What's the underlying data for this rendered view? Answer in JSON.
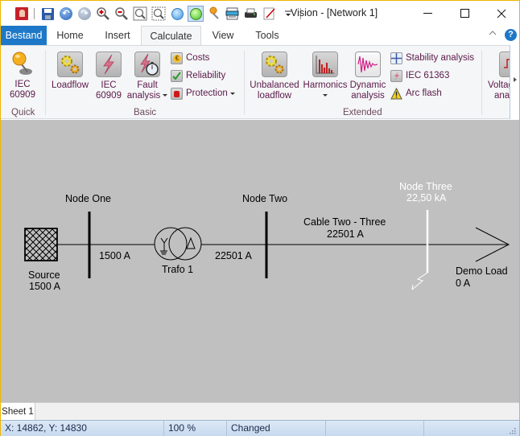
{
  "window": {
    "title": "Vision - [Network 1]",
    "minimize": "—",
    "maximize": "☐",
    "close": "✕"
  },
  "quick_access": [
    {
      "name": "app-logo-icon"
    },
    {
      "name": "save-icon"
    },
    {
      "name": "undo-icon"
    },
    {
      "name": "redo-icon"
    },
    {
      "name": "zoom-in-icon"
    },
    {
      "name": "zoom-out-icon"
    },
    {
      "name": "zoom-fit-icon"
    },
    {
      "name": "zoom-selection-icon"
    },
    {
      "name": "blue-circle-icon"
    },
    {
      "name": "green-circle-icon",
      "active": true
    },
    {
      "name": "pin-icon"
    },
    {
      "name": "monitor-icon"
    },
    {
      "name": "print-icon"
    },
    {
      "name": "edit-icon"
    },
    {
      "name": "customize-dropdown-icon"
    }
  ],
  "ribbon_tabs": {
    "file": "Bestand",
    "home": "Home",
    "insert": "Insert",
    "calculate": "Calculate",
    "view": "View",
    "tools": "Tools",
    "active": "Calculate",
    "collapse": "^",
    "help": "?"
  },
  "ribbon": {
    "quick": {
      "label": "Quick",
      "iec_line1": "IEC",
      "iec_line2": "60909"
    },
    "basic": {
      "label": "Basic",
      "loadflow": "Loadflow",
      "iec_line1": "IEC",
      "iec_line2": "60909",
      "fault_line1": "Fault",
      "fault_line2": "analysis",
      "costs": "Costs",
      "reliability": "Reliability",
      "protection": "Protection"
    },
    "extended": {
      "label": "Extended",
      "unbalanced_line1": "Unbalanced",
      "unbalanced_line2": "loadflow",
      "harmonics": "Harmonics",
      "dynamic_line1": "Dynamic",
      "dynamic_line2": "analysis",
      "stability": "Stability analysis",
      "iec61363": "IEC 61363",
      "arcflash": "Arc flash"
    },
    "voltage": {
      "line1": "Voltag",
      "line2": "ana"
    }
  },
  "diagram": {
    "source": {
      "name": "Source",
      "current": "1500 A"
    },
    "node_one": {
      "name": "Node One"
    },
    "link_one_current": "1500 A",
    "trafo": {
      "name": "Trafo 1",
      "primary": "Y",
      "secondary": "Δ"
    },
    "link_two_current": "22501 A",
    "node_two": {
      "name": "Node Two"
    },
    "cable": {
      "name": "Cable Two - Three",
      "current": "22501 A"
    },
    "node_three": {
      "name": "Node Three",
      "fault_current": "22,50 kA"
    },
    "load": {
      "name": "Demo Load",
      "current": "0 A"
    }
  },
  "sheets": [
    "Sheet 1"
  ],
  "status": {
    "coords": "X: 14862, Y: 14830",
    "zoom": "100 %",
    "state": "Changed"
  }
}
